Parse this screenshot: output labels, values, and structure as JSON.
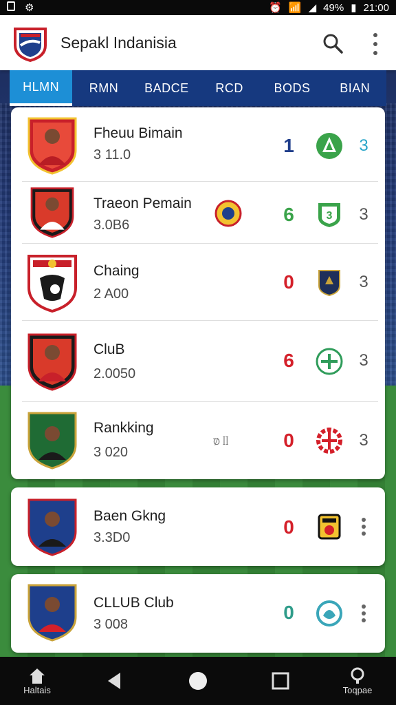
{
  "status_bar": {
    "battery": "49%",
    "time": "21:00"
  },
  "app": {
    "title": "Sepakl Indanisia"
  },
  "tabs": [
    {
      "label": "HLMN",
      "active": true
    },
    {
      "label": "RMN",
      "active": false
    },
    {
      "label": "BADCE",
      "active": false
    },
    {
      "label": "RCD",
      "active": false
    },
    {
      "label": "BODS",
      "active": false
    },
    {
      "label": "BIAN",
      "active": false
    }
  ],
  "players": [
    {
      "name": "Fheuu Bimain",
      "sub": "3 11.0",
      "score": "1",
      "score_color": "#1f3d8a",
      "badge_icon": "green-hazard-badge-icon",
      "rank": "3",
      "rank_color": "#2aa6c9"
    },
    {
      "name": "Traeon Pemain",
      "sub": "3.0B6",
      "score": "6",
      "score_color": "#3aa34a",
      "badge_icon": "green-shield-badge-icon",
      "rank": "3",
      "rank_color": "#555555"
    },
    {
      "name": "Chaing",
      "sub": "2 A00",
      "score": "0",
      "score_color": "#d4202a",
      "badge_icon": "navy-gold-shield-icon",
      "rank": "3",
      "rank_color": "#555555"
    },
    {
      "name": "CluB",
      "sub": "2.0050",
      "score": "6",
      "score_color": "#d4202a",
      "badge_icon": "green-circle-badge-icon",
      "rank": "3",
      "rank_color": "#555555"
    },
    {
      "name": "Rankking",
      "sub": "3 020",
      "score": "0",
      "score_color": "#d4202a",
      "badge_icon": "red-gear-badge-icon",
      "rank": "3",
      "rank_color": "#555555"
    },
    {
      "name": "Baen Gkng",
      "sub": "3.3D0",
      "score": "0",
      "score_color": "#d4202a",
      "badge_icon": "black-yellow-badge-icon"
    },
    {
      "name": "CLLUB Club",
      "sub": "3 008",
      "score": "0",
      "score_color": "#2f9c8a",
      "badge_icon": "teal-crest-badge-icon"
    }
  ],
  "row_mini_text": "Ꝺ̸ ꟾꟾ",
  "nav": {
    "home_label": "Haltais",
    "right_label": "Toqpae"
  },
  "colors": {
    "primary_blue": "#16397f",
    "active_tab": "#1d8fd6",
    "accent_red": "#d4202a"
  }
}
